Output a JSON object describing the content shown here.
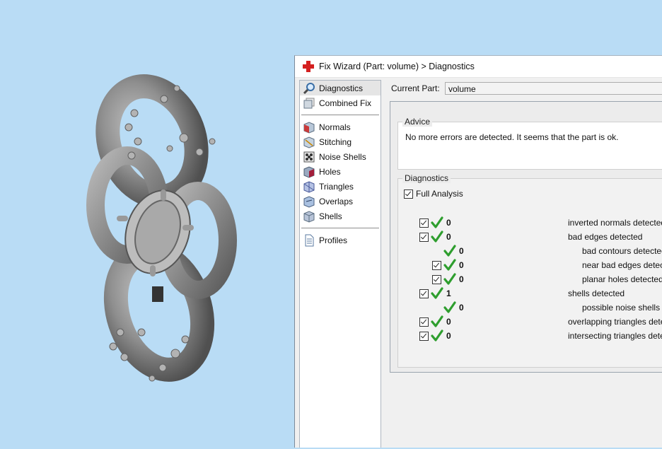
{
  "window": {
    "title": "Fix Wizard (Part: volume) > Diagnostics"
  },
  "nav": {
    "group1": [
      {
        "label": "Diagnostics",
        "icon": "magnifier-icon",
        "selected": true
      },
      {
        "label": "Combined Fix",
        "icon": "cube-pages-icon"
      }
    ],
    "group2": [
      {
        "label": "Normals",
        "icon": "normals-cube-icon"
      },
      {
        "label": "Stitching",
        "icon": "stitching-cube-icon"
      },
      {
        "label": "Noise Shells",
        "icon": "noise-shells-icon"
      },
      {
        "label": "Holes",
        "icon": "holes-cube-icon"
      },
      {
        "label": "Triangles",
        "icon": "triangles-cube-icon"
      },
      {
        "label": "Overlaps",
        "icon": "overlaps-cube-icon"
      },
      {
        "label": "Shells",
        "icon": "shells-cube-icon"
      }
    ],
    "group3": [
      {
        "label": "Profiles",
        "icon": "document-icon"
      }
    ]
  },
  "current_part": {
    "label": "Current Part:",
    "value": "volume"
  },
  "advice": {
    "title": "Advice",
    "message": "No more errors are detected. It seems that the part is ok."
  },
  "diagnostics": {
    "title": "Diagnostics",
    "full_analysis_label": "Full Analysis",
    "rows": [
      {
        "count": "0",
        "label": "inverted normals detected",
        "indent": 0,
        "checkbox": true
      },
      {
        "count": "0",
        "label": "bad edges detected",
        "indent": 0,
        "checkbox": true
      },
      {
        "count": "0",
        "label": "bad contours detected",
        "indent": 1,
        "checkbox": false
      },
      {
        "count": "0",
        "label": "near bad edges detected",
        "indent": 1,
        "checkbox": true
      },
      {
        "count": "0",
        "label": "planar holes detected",
        "indent": 1,
        "checkbox": true
      },
      {
        "count": "1",
        "label": "shells detected",
        "indent": 0,
        "checkbox": true
      },
      {
        "count": "0",
        "label": "possible noise shells detected",
        "indent": 1,
        "checkbox": false
      },
      {
        "count": "0",
        "label": "overlapping triangles detected",
        "indent": 0,
        "checkbox": true
      },
      {
        "count": "0",
        "label": "intersecting triangles detected",
        "indent": 0,
        "checkbox": true
      }
    ]
  },
  "colors": {
    "viewport_bg": "#b9dcf5",
    "check_green": "#2e9e2e",
    "app_icon_red": "#d42020"
  }
}
